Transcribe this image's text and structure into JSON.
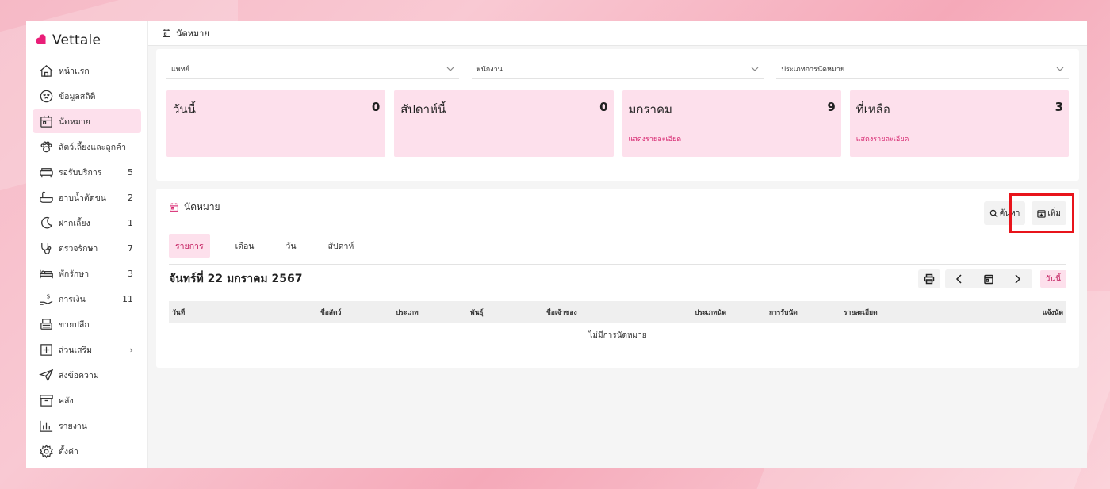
{
  "brand": {
    "name": "Vettale",
    "logo_color": "#e91e78"
  },
  "sidebar": {
    "items": [
      {
        "label": "หน้าแรก",
        "icon": "home-icon",
        "count": ""
      },
      {
        "label": "ข้อมูลสถิติ",
        "icon": "stats-icon",
        "count": ""
      },
      {
        "label": "นัดหมาย",
        "icon": "calendar-icon",
        "count": "",
        "active": true
      },
      {
        "label": "สัตว์เลี้ยงและลูกค้า",
        "icon": "paw-icon",
        "count": ""
      },
      {
        "label": "รอรับบริการ",
        "icon": "sofa-icon",
        "count": "5"
      },
      {
        "label": "อาบน้ำตัดขน",
        "icon": "bathtub-icon",
        "count": "2"
      },
      {
        "label": "ฝากเลี้ยง",
        "icon": "moon-icon",
        "count": "1"
      },
      {
        "label": "ตรวจรักษา",
        "icon": "stethoscope-icon",
        "count": "7"
      },
      {
        "label": "พักรักษา",
        "icon": "bed-icon",
        "count": "3"
      },
      {
        "label": "การเงิน",
        "icon": "money-hand-icon",
        "count": "11"
      },
      {
        "label": "ขายปลีก",
        "icon": "register-icon",
        "count": ""
      },
      {
        "label": "ส่วนเสริม",
        "icon": "plus-box-icon",
        "count": "",
        "chevron": "›"
      },
      {
        "label": "ส่งข้อความ",
        "icon": "send-icon",
        "count": ""
      },
      {
        "label": "คลัง",
        "icon": "archive-icon",
        "count": ""
      },
      {
        "label": "รายงาน",
        "icon": "chart-icon",
        "count": ""
      },
      {
        "label": "ตั้งค่า",
        "icon": "gear-icon",
        "count": ""
      }
    ]
  },
  "topbar": {
    "title": "นัดหมาย"
  },
  "filters": [
    {
      "label": "แพทย์"
    },
    {
      "label": "พนักงาน"
    },
    {
      "label": "ประเภทการนัดหมาย"
    }
  ],
  "stats": [
    {
      "label": "วันนี้",
      "value": "0",
      "link": ""
    },
    {
      "label": "สัปดาห์นี้",
      "value": "0",
      "link": ""
    },
    {
      "label": "มกราคม",
      "value": "9",
      "link": "แสดงรายละเอียด"
    },
    {
      "label": "ที่เหลือ",
      "value": "3",
      "link": "แสดงรายละเอียด"
    }
  ],
  "appointments": {
    "title": "นัดหมาย",
    "search_label": "ค้นหา",
    "add_label": "เพิ่ม",
    "tabs": [
      "รายการ",
      "เดือน",
      "วัน",
      "สัปดาห์"
    ],
    "date_title": "จันทร์ที่ 22 มกราคม 2567",
    "today_label": "วันนี้",
    "columns": [
      "วันที่",
      "ชื่อสัตว์",
      "ประเภท",
      "พันธุ์",
      "ชื่อเจ้าของ",
      "ประเภทนัด",
      "การรับนัด",
      "รายละเอียด",
      "แจ้งนัด"
    ],
    "empty_text": "ไม่มีการนัดหมาย"
  },
  "colors": {
    "accent": "#d6246e",
    "card_bg": "#fde0ec",
    "highlight": "#e8141b"
  }
}
